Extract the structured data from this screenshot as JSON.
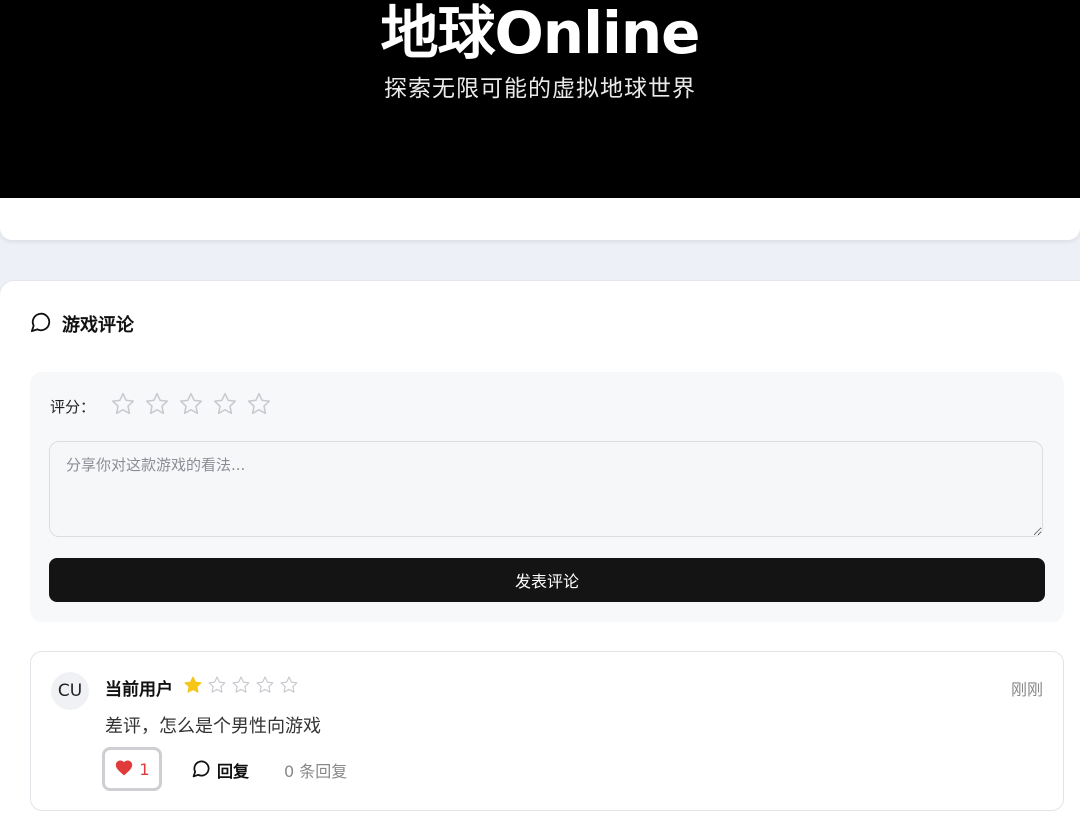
{
  "hero": {
    "title": "地球Online",
    "subtitle": "探索无限可能的虚拟地球世界"
  },
  "comments_section": {
    "title": "游戏评论",
    "icon": "comment-icon",
    "form": {
      "rating_label": "评分：",
      "rating_value": 0,
      "rating_max": 5,
      "textarea_placeholder": "分享你对这款游戏的看法...",
      "textarea_value": "",
      "submit_label": "发表评论"
    },
    "comments": [
      {
        "avatar": "CU",
        "user": "当前用户",
        "rating": 1,
        "rating_max": 5,
        "time": "刚刚",
        "text": "差评，怎么是个男性向游戏",
        "likes": "1",
        "reply_label": "回复",
        "reply_count_text": "0 条回复"
      }
    ]
  },
  "colors": {
    "star_filled": "#f5c518",
    "star_empty": "#c8c9cf",
    "heart": "#e03a3a",
    "button_dark": "#141414"
  }
}
